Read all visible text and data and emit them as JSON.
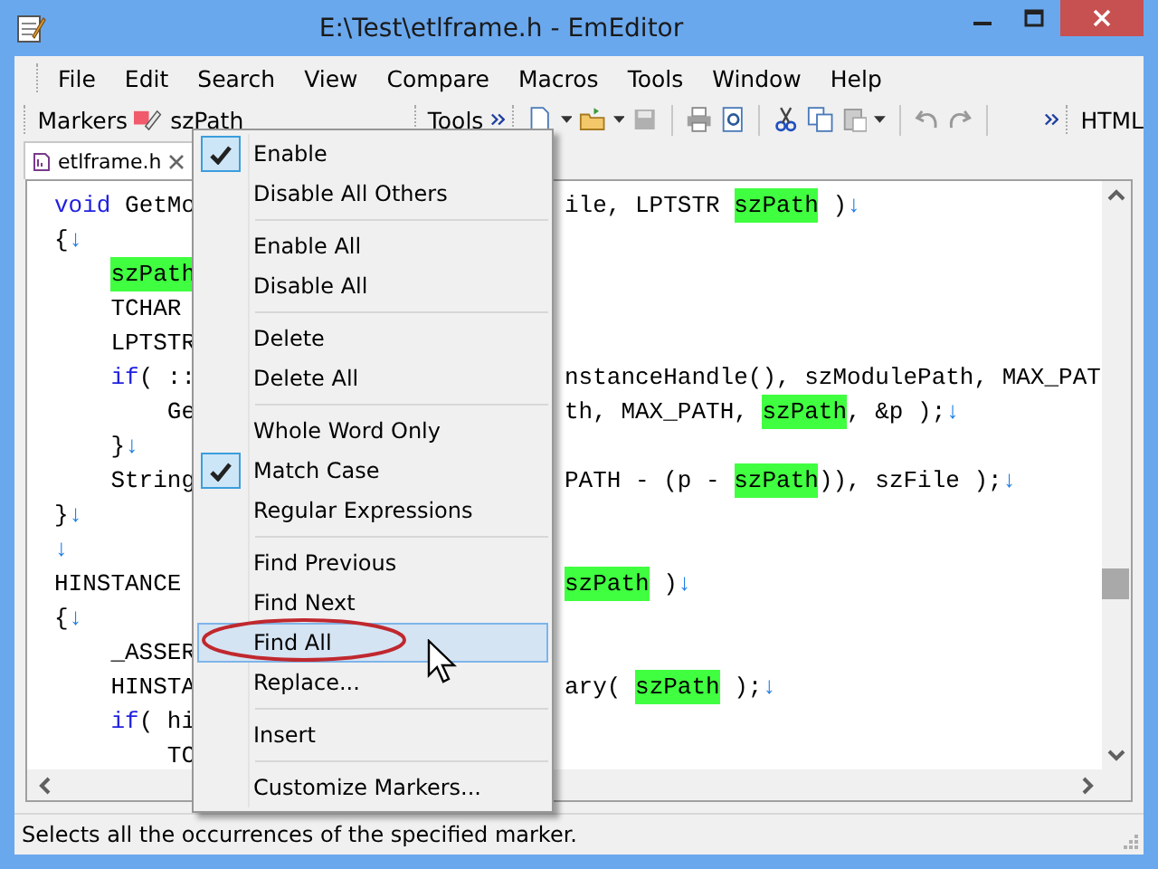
{
  "window": {
    "title": "E:\\Test\\etlframe.h - EmEditor"
  },
  "menu_bar": [
    "File",
    "Edit",
    "Search",
    "View",
    "Compare",
    "Macros",
    "Tools",
    "Window",
    "Help"
  ],
  "markers_toolbar": {
    "label": "Markers",
    "marker": "szPath"
  },
  "tools_toolbar": {
    "label": "Tools"
  },
  "html_toolbar": {
    "label": "HTML"
  },
  "tabs": [
    {
      "label": "etlframe.h",
      "selected": true
    }
  ],
  "editor": {
    "lines": [
      {
        "kind": "top",
        "left": [
          {
            "kind": "kw",
            "text": "void"
          },
          {
            "kind": "plain",
            "text": " GetMo"
          }
        ],
        "right": [
          {
            "kind": "plain",
            "text": "ile, LPTSTR "
          },
          {
            "kind": "mark",
            "text": "szPath"
          },
          {
            "kind": "plain",
            "text": " )"
          },
          {
            "kind": "eol",
            "text": "↓"
          }
        ]
      },
      {
        "kind": "top",
        "left": [
          {
            "kind": "plain",
            "text": "{"
          },
          {
            "kind": "eol",
            "text": "↓"
          }
        ]
      },
      {
        "kind": "nested",
        "left": [
          {
            "kind": "mark",
            "text": "szPath"
          }
        ]
      },
      {
        "kind": "top",
        "left": [
          {
            "kind": "plain",
            "text": "    TCHAR"
          }
        ]
      },
      {
        "kind": "top",
        "left": [
          {
            "kind": "plain",
            "text": "    LPTSTR"
          }
        ]
      },
      {
        "kind": "nested",
        "left": [
          {
            "kind": "kw",
            "text": "if"
          },
          {
            "kind": "plain",
            "text": "( ::"
          }
        ],
        "right": [
          {
            "kind": "plain",
            "text": "nstanceHandle(), szModulePath, MAX_PAT"
          }
        ]
      },
      {
        "kind": "top",
        "left": [
          {
            "kind": "plain",
            "text": "        Ge"
          }
        ],
        "right": [
          {
            "kind": "plain",
            "text": "th, MAX_PATH, "
          },
          {
            "kind": "mark",
            "text": "szPath"
          },
          {
            "kind": "plain",
            "text": ", &p );"
          },
          {
            "kind": "eol",
            "text": "↓"
          }
        ]
      },
      {
        "kind": "top",
        "left": [
          {
            "kind": "plain",
            "text": "    }"
          },
          {
            "kind": "eol",
            "text": "↓"
          }
        ]
      },
      {
        "kind": "top",
        "left": [
          {
            "kind": "plain",
            "text": "    String"
          }
        ],
        "right": [
          {
            "kind": "plain",
            "text": "PATH - (p - "
          },
          {
            "kind": "mark",
            "text": "szPath"
          },
          {
            "kind": "plain",
            "text": ")), szFile );"
          },
          {
            "kind": "eol",
            "text": "↓"
          }
        ]
      },
      {
        "kind": "top",
        "left": [
          {
            "kind": "plain",
            "text": "}"
          },
          {
            "kind": "eol",
            "text": "↓"
          }
        ]
      },
      {
        "kind": "top",
        "left": [
          {
            "kind": "eol",
            "text": "↓"
          }
        ]
      },
      {
        "kind": "top",
        "left": [
          {
            "kind": "plain",
            "text": "HINSTANCE"
          }
        ],
        "right": [
          {
            "kind": "mark",
            "text": "szPath"
          },
          {
            "kind": "plain",
            "text": " )"
          },
          {
            "kind": "eol",
            "text": "↓"
          }
        ]
      },
      {
        "kind": "top",
        "left": [
          {
            "kind": "plain",
            "text": "{"
          },
          {
            "kind": "eol",
            "text": "↓"
          }
        ]
      },
      {
        "kind": "top",
        "left": [
          {
            "kind": "plain",
            "text": "    _ASSER"
          }
        ]
      },
      {
        "kind": "top",
        "left": [
          {
            "kind": "plain",
            "text": "    HINSTA"
          }
        ],
        "right": [
          {
            "kind": "plain",
            "text": "ary( "
          },
          {
            "kind": "mark",
            "text": "szPath"
          },
          {
            "kind": "plain",
            "text": " );"
          },
          {
            "kind": "eol",
            "text": "↓"
          }
        ]
      },
      {
        "kind": "nested",
        "left": [
          {
            "kind": "kw",
            "text": "if"
          },
          {
            "kind": "plain",
            "text": "( hi"
          }
        ]
      },
      {
        "kind": "top",
        "left": [
          {
            "kind": "plain",
            "text": "        TC"
          }
        ]
      }
    ]
  },
  "context_menu": {
    "items": [
      {
        "kind": "item",
        "label": "Enable",
        "checked": true,
        "selected": false
      },
      {
        "kind": "item",
        "label": "Disable All Others",
        "checked": false,
        "selected": false
      },
      {
        "kind": "separator"
      },
      {
        "kind": "item",
        "label": "Enable All",
        "checked": false,
        "selected": false
      },
      {
        "kind": "item",
        "label": "Disable All",
        "checked": false,
        "selected": false
      },
      {
        "kind": "separator"
      },
      {
        "kind": "item",
        "label": "Delete",
        "checked": false,
        "selected": false
      },
      {
        "kind": "item",
        "label": "Delete All",
        "checked": false,
        "selected": false
      },
      {
        "kind": "separator"
      },
      {
        "kind": "item",
        "label": "Whole Word Only",
        "checked": false,
        "selected": false
      },
      {
        "kind": "item",
        "label": "Match Case",
        "checked": true,
        "selected": false
      },
      {
        "kind": "item",
        "label": "Regular Expressions",
        "checked": false,
        "selected": false
      },
      {
        "kind": "separator"
      },
      {
        "kind": "item",
        "label": "Find Previous",
        "checked": false,
        "selected": false
      },
      {
        "kind": "item",
        "label": "Find Next",
        "checked": false,
        "selected": false
      },
      {
        "kind": "item",
        "label": "Find All",
        "checked": false,
        "selected": true
      },
      {
        "kind": "item",
        "label": "Replace...",
        "checked": false,
        "selected": false
      },
      {
        "kind": "separator"
      },
      {
        "kind": "item",
        "label": "Insert",
        "checked": false,
        "selected": false
      },
      {
        "kind": "separator"
      },
      {
        "kind": "item",
        "label": "Customize Markers...",
        "checked": false,
        "selected": false
      }
    ]
  },
  "status_bar": "Selects all the occurrences of the specified marker."
}
